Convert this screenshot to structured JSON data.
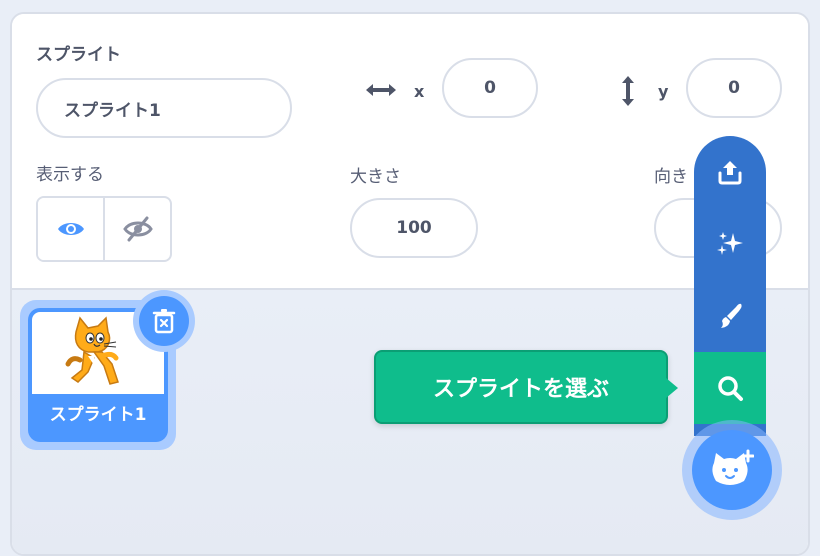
{
  "sprite_info": {
    "sprite_label": "スプライト",
    "sprite_name_value": "スプライト1",
    "x_label": "x",
    "x_value": "0",
    "y_label": "y",
    "y_value": "0",
    "show_label": "表示する",
    "size_label": "大きさ",
    "size_value": "100",
    "direction_label": "向き"
  },
  "sprite_list": {
    "items": [
      {
        "name": "スプライト1",
        "selected": true
      }
    ]
  },
  "add_sprite_menu": {
    "items": [
      {
        "icon": "upload-icon"
      },
      {
        "icon": "surprise-icon"
      },
      {
        "icon": "paint-icon"
      },
      {
        "icon": "search-icon",
        "active": true
      }
    ],
    "tooltip": "スプライトを選ぶ",
    "main_icon": "cat-plus-icon"
  },
  "colors": {
    "blue": "#4c97ff",
    "dark_blue": "#3373cc",
    "green": "#0fbd8c"
  }
}
